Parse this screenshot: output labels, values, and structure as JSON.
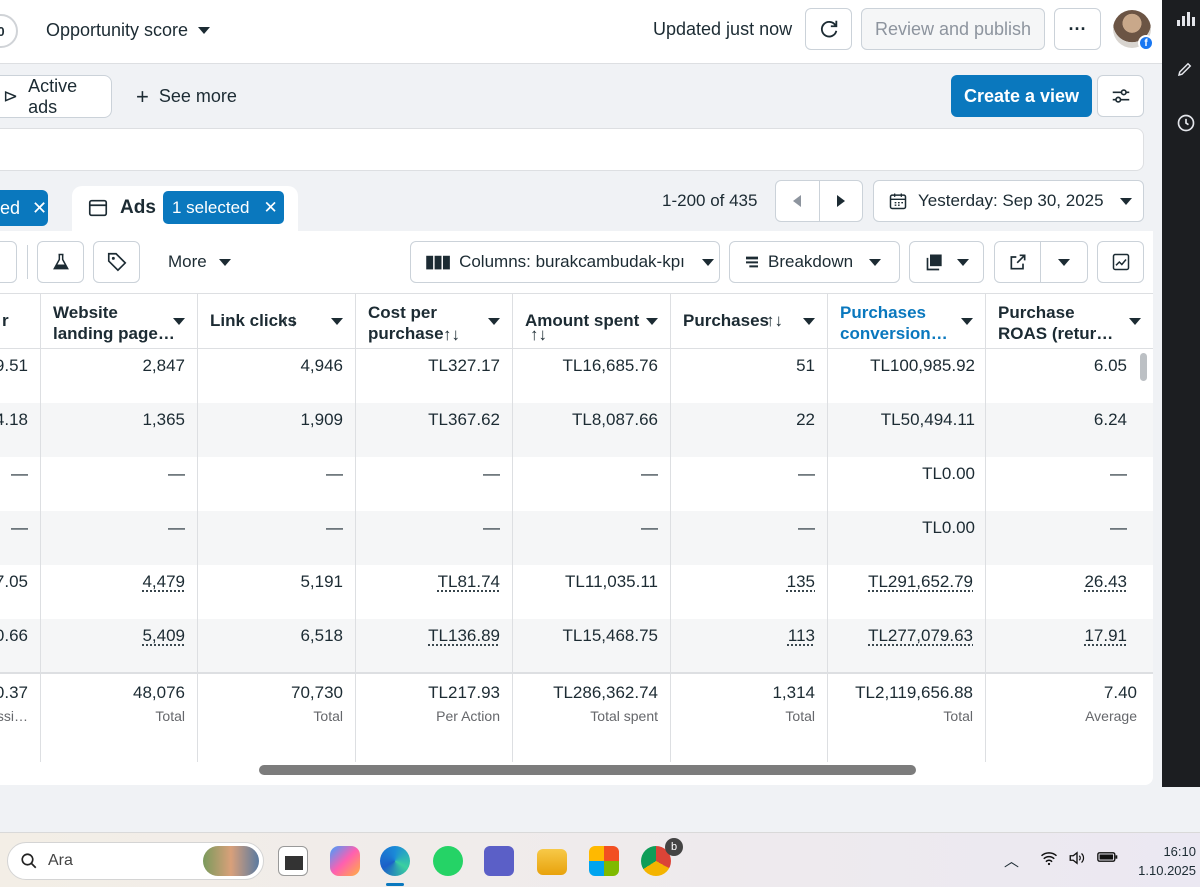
{
  "header": {
    "score_value": "0",
    "opportunity_label": "Opportunity score",
    "updated_text": "Updated just now",
    "review_label": "Review and publish",
    "more_glyph": "···"
  },
  "filters": {
    "active_ads_label": "Active ads",
    "see_more_label": "See more",
    "create_view_label": "Create a view"
  },
  "tabs": {
    "left_tab_fragment": "ed",
    "ads_label": "Ads",
    "selected_label": "1 selected"
  },
  "pagination": {
    "range_text": "1-200 of 435",
    "date_label": "Yesterday: Sep 30, 2025"
  },
  "toolbar": {
    "more_label": "More",
    "columns_label": "Columns: burakcambudak-kpı",
    "breakdown_label": "Breakdown"
  },
  "table": {
    "columns": [
      {
        "line1": "r",
        "line2": "",
        "sort": false
      },
      {
        "line1": "Website",
        "line2": "landing page…",
        "sort": false
      },
      {
        "line1": "Link clicks",
        "line2": "",
        "sort": true
      },
      {
        "line1": "Cost per",
        "line2": "purchase",
        "sort": true
      },
      {
        "line1": "Amount spent",
        "line2": "",
        "sort": true
      },
      {
        "line1": "Purchases",
        "line2": "",
        "sort": true
      },
      {
        "line1": "Purchases",
        "line2": "conversion…",
        "sort": false
      },
      {
        "line1": "Purchase",
        "line2": "ROAS (retur…",
        "sort": false
      }
    ],
    "sort_glyph": "↑↓",
    "rows": [
      [
        "9.51",
        "2,847",
        "4,946",
        "TL327.17",
        "TL16,685.76",
        "51",
        "TL100,985.92",
        "6.05"
      ],
      [
        "4.18",
        "1,365",
        "1,909",
        "TL367.62",
        "TL8,087.66",
        "22",
        "TL50,494.11",
        "6.24"
      ],
      [
        "—",
        "—",
        "—",
        "—",
        "—",
        "—",
        "TL0.00",
        "—"
      ],
      [
        "—",
        "—",
        "—",
        "—",
        "—",
        "—",
        "TL0.00",
        "—"
      ],
      [
        "7.05",
        "4,479",
        "5,191",
        "TL81.74",
        "TL11,035.11",
        "135",
        "TL291,652.79",
        "26.43"
      ],
      [
        "0.66",
        "5,409",
        "6,518",
        "TL136.89",
        "TL15,468.75",
        "113",
        "TL277,079.63",
        "17.91"
      ]
    ],
    "totals": [
      {
        "value": "0.37",
        "sub": "ssi…"
      },
      {
        "value": "48,076",
        "sub": "Total"
      },
      {
        "value": "70,730",
        "sub": "Total"
      },
      {
        "value": "TL217.93",
        "sub": "Per Action"
      },
      {
        "value": "TL286,362.74",
        "sub": "Total spent"
      },
      {
        "value": "1,314",
        "sub": "Total"
      },
      {
        "value": "TL2,119,656.88",
        "sub": "Total"
      },
      {
        "value": "7.40",
        "sub": "Average"
      }
    ]
  },
  "taskbar": {
    "search_placeholder": "Ara",
    "time": "16:10",
    "date": "1.10.2025",
    "chrome_badge": "b"
  },
  "colors": {
    "accent": "#0a78be",
    "dark_strip": "#1c1e21"
  }
}
